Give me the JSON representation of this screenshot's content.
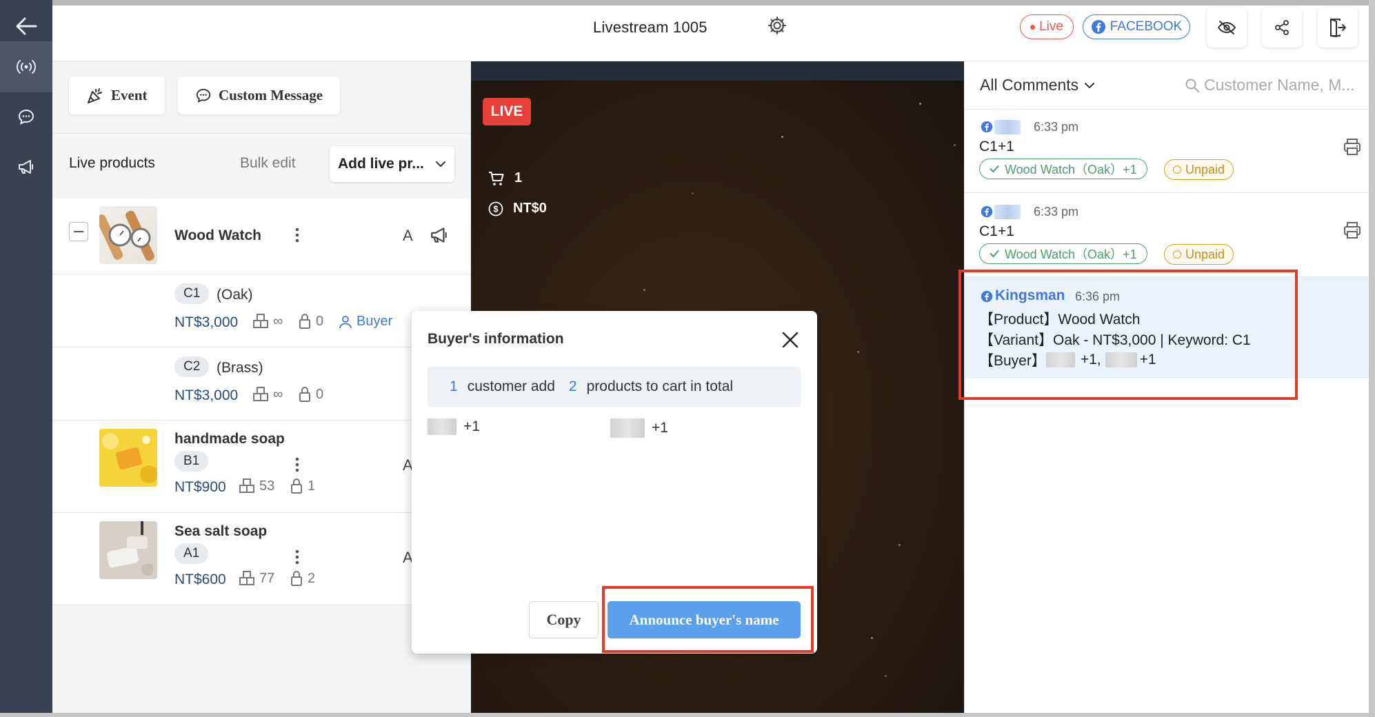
{
  "header": {
    "stream_title": "Livestream 1005",
    "live_badge": "Live",
    "platform_badge": "FACEBOOK"
  },
  "toolbar": {
    "event_label": "Event",
    "custom_message_label": "Custom Message"
  },
  "products_panel": {
    "label": "Live products",
    "bulk_edit": "Bulk edit",
    "add_button": "Add live pr...",
    "products": [
      {
        "name": "Wood Watch",
        "action_letter": "A",
        "variants": [
          {
            "keyword": "C1",
            "variant": "(Oak)",
            "price": "NT$3,000",
            "stock": "∞",
            "locked": "0",
            "buyer_label": "Buyer"
          },
          {
            "keyword": "C2",
            "variant": "(Brass)",
            "price": "NT$3,000",
            "stock": "∞",
            "locked": "0"
          }
        ]
      },
      {
        "name": "handmade soap",
        "keyword": "B1",
        "price": "NT$900",
        "stock": "53",
        "locked": "1",
        "action_letter": "A"
      },
      {
        "name": "Sea salt soap",
        "keyword": "A1",
        "price": "NT$600",
        "stock": "77",
        "locked": "2",
        "action_letter": "A"
      }
    ]
  },
  "video": {
    "live_tag": "LIVE",
    "cart_count": "1",
    "revenue": "NT$0"
  },
  "comments": {
    "filter_label": "All Comments",
    "search_placeholder": "Customer Name, M...",
    "items": [
      {
        "time": "6:33 pm",
        "text": "C1+1",
        "order_tag": "Wood Watch（Oak）+1",
        "payment_status": "Unpaid"
      },
      {
        "time": "6:33 pm",
        "text": "C1+1",
        "order_tag": "Wood Watch（Oak）+1",
        "payment_status": "Unpaid"
      },
      {
        "author": "Kingsman",
        "time": "6:36 pm",
        "line1": "【Product】Wood Watch",
        "line2": "【Variant】Oak - NT$3,000 | Keyword: C1",
        "line3_prefix": "【Buyer】",
        "buyer1_qty": "+1,",
        "buyer2_qty": "+1"
      }
    ]
  },
  "modal": {
    "title": "Buyer's information",
    "customer_count": "1",
    "customer_text": "customer add",
    "product_count": "2",
    "product_text": "products to cart in total",
    "buyers": [
      {
        "qty": "+1"
      },
      {
        "qty": "+1"
      }
    ],
    "copy_label": "Copy",
    "announce_label": "Announce buyer's name"
  },
  "colors": {
    "sidebar": "#3a4150",
    "accent_blue": "#3f78de",
    "live_red": "#e64037",
    "announce_button": "#5aa0ec",
    "paid_green": "#4e9e6c",
    "unpaid_orange": "#d9a128",
    "highlight_box": "#e23a2b"
  }
}
